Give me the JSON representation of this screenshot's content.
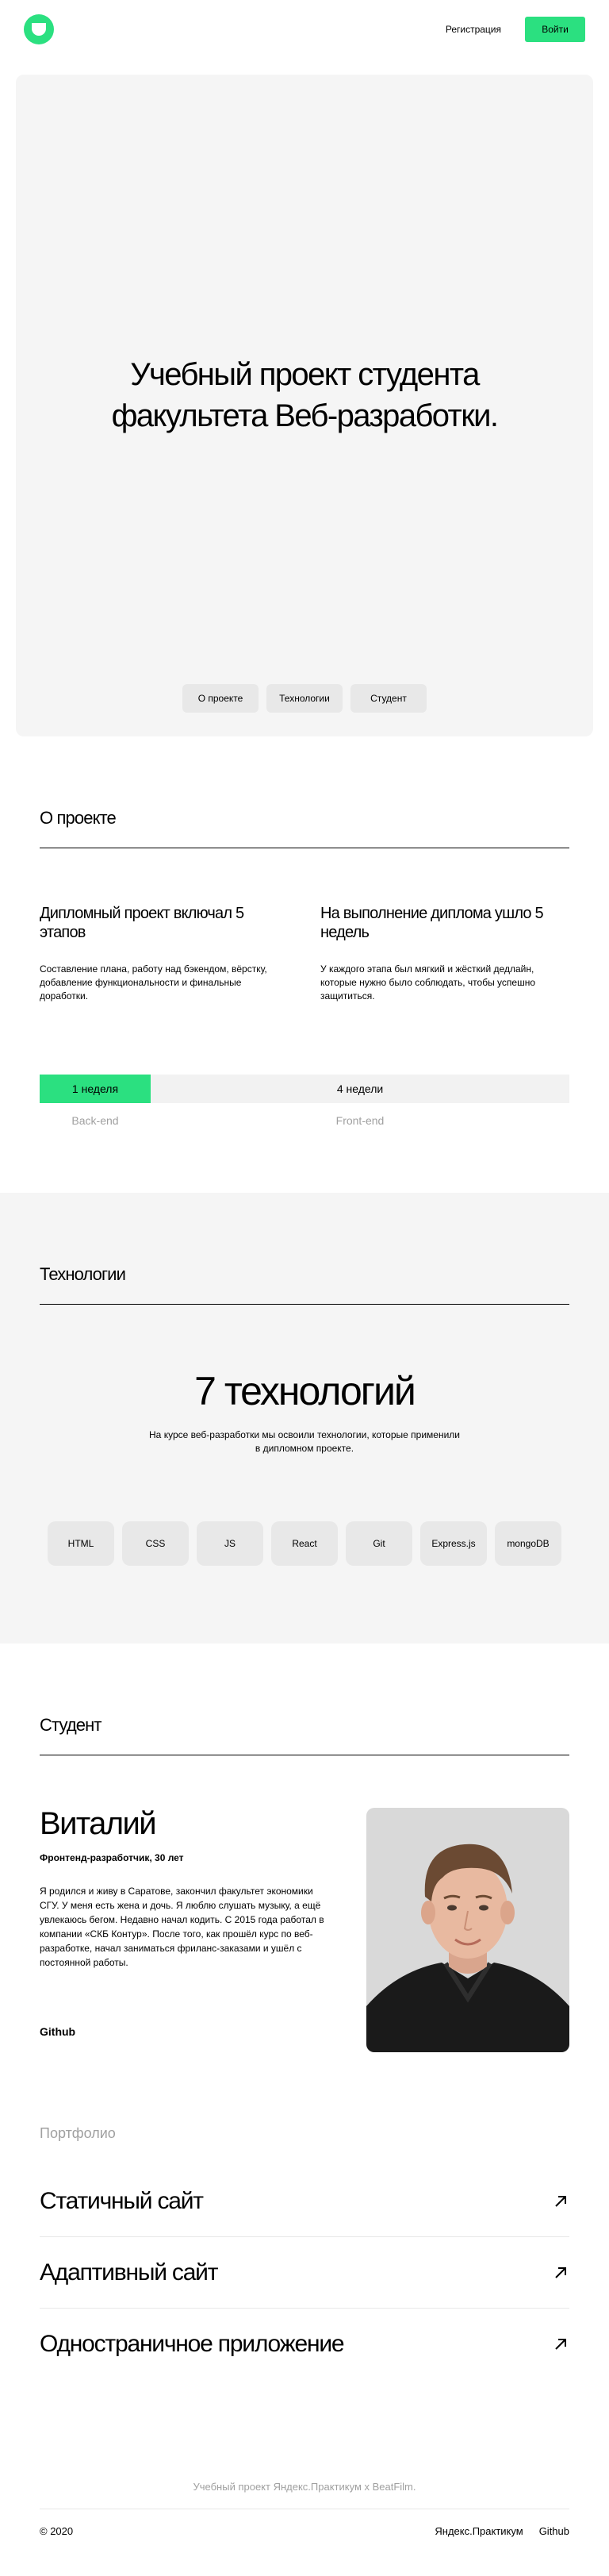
{
  "header": {
    "register_label": "Регистрация",
    "login_label": "Войти"
  },
  "promo": {
    "title_line1": "Учебный проект студента",
    "title_line2": "факультета Веб-разработки.",
    "nav": [
      "О проекте",
      "Технологии",
      "Студент"
    ]
  },
  "about": {
    "title": "О проекте",
    "col1_heading": "Дипломный проект включал 5 этапов",
    "col1_text": "Составление плана, работу над бэкендом, вёрстку, добавление функциональности и финальные доработки.",
    "col2_heading": "На выполнение диплома ушло 5 недель",
    "col2_text": "У каждого этапа был мягкий и жёсткий дедлайн, которые нужно было соблюдать, чтобы успешно защититься.",
    "timeline_week": "1 неделя",
    "timeline_rest": "4 недели",
    "timeline_backend": "Back-end",
    "timeline_frontend": "Front-end"
  },
  "techs": {
    "title": "Технологии",
    "heading": "7 технологий",
    "description": "На курсе веб-разработки мы освоили технологии, которые применили в дипломном проекте.",
    "items": [
      "HTML",
      "CSS",
      "JS",
      "React",
      "Git",
      "Express.js",
      "mongoDB"
    ]
  },
  "student": {
    "title": "Студент",
    "name": "Виталий",
    "job": "Фронтенд-разработчик, 30 лет",
    "bio": "Я родился и живу в Саратове, закончил факультет экономики СГУ. У меня есть жена и дочь. Я люблю слушать музыку, а ещё увлекаюсь бегом. Недавно начал кодить. С 2015 года работал в компании «СКБ Контур». После того, как прошёл курс по веб-разработке, начал заниматься фриланс-заказами и ушёл с постоянной работы.",
    "github": "Github"
  },
  "portfolio": {
    "title": "Портфолио",
    "items": [
      "Статичный сайт",
      "Адаптивный сайт",
      "Одностраничное приложение"
    ]
  },
  "footer": {
    "caption": "Учебный проект Яндекс.Практикум х BeatFilm.",
    "copyright": "© 2020",
    "link_praktikum": "Яндекс.Практикум",
    "link_github": "Github"
  },
  "colors": {
    "accent": "#2be080",
    "panel": "#f5f5f5"
  }
}
